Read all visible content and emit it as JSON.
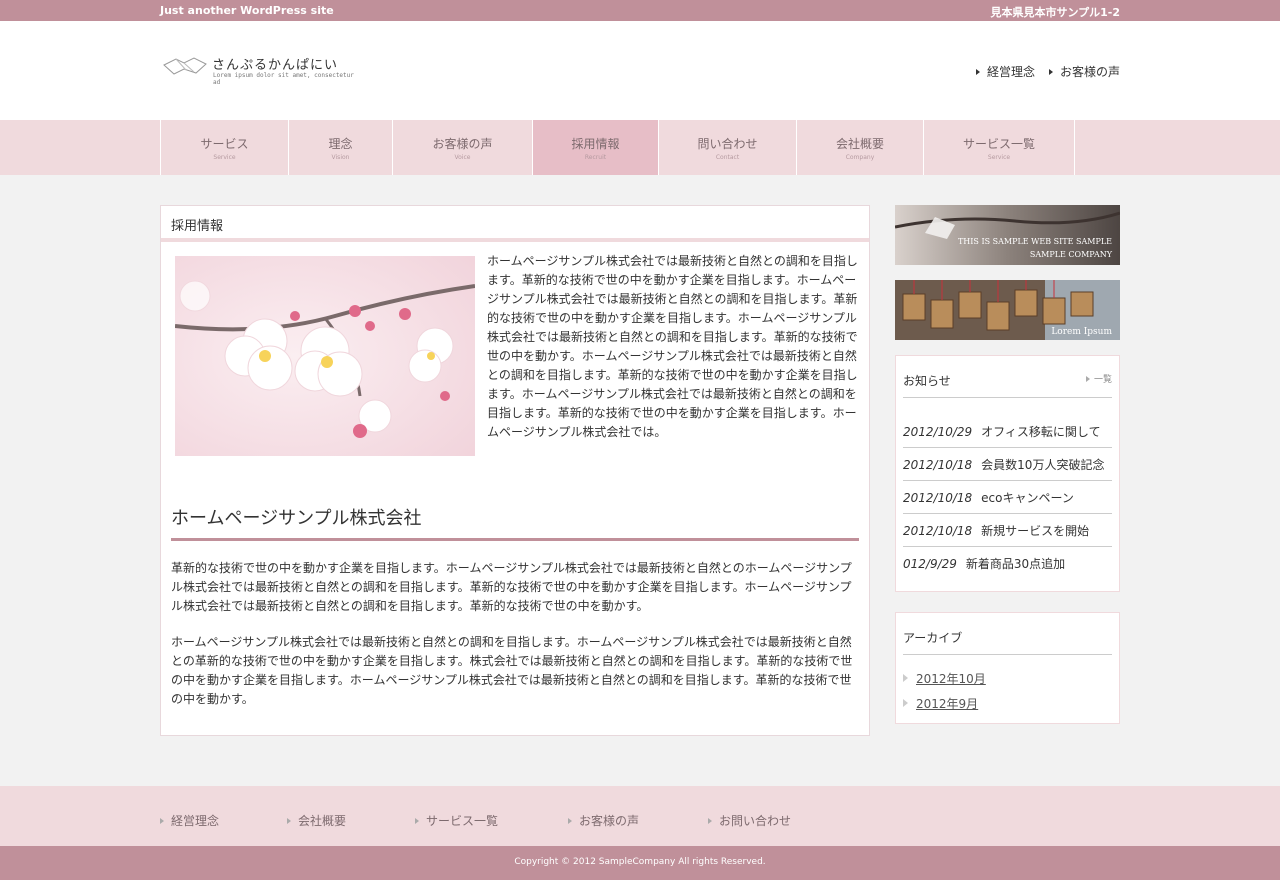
{
  "topbar": {
    "tagline": "Just another WordPress site",
    "address": "見本県見本市サンプル1-2"
  },
  "logo": {
    "name": "さんぷるかんぱにい",
    "tagline": "Lorem ipsum dolor sit amet, consectetur ad"
  },
  "header_links": [
    "経営理念",
    "お客様の声"
  ],
  "nav": [
    {
      "label": "サービス",
      "sub": "Service",
      "active": false
    },
    {
      "label": "理念",
      "sub": "Vision",
      "active": false
    },
    {
      "label": "お客様の声",
      "sub": "Voice",
      "active": false
    },
    {
      "label": "採用情報",
      "sub": "Recruit",
      "active": true
    },
    {
      "label": "問い合わせ",
      "sub": "Contact",
      "active": false
    },
    {
      "label": "会社概要",
      "sub": "Company",
      "active": false
    },
    {
      "label": "サービス一覧",
      "sub": "Service",
      "active": false
    }
  ],
  "main": {
    "title": "採用情報",
    "intro": "ホームページサンプル株式会社では最新技術と自然との調和を目指します。革新的な技術で世の中を動かす企業を目指します。ホームページサンプル株式会社では最新技術と自然との調和を目指します。革新的な技術で世の中を動かす企業を目指します。ホームページサンプル株式会社では最新技術と自然との調和を目指します。革新的な技術で世の中を動かす。ホームページサンプル株式会社では最新技術と自然との調和を目指します。革新的な技術で世の中を動かす企業を目指します。ホームページサンプル株式会社では最新技術と自然との調和を目指します。革新的な技術で世の中を動かす企業を目指します。ホームページサンプル株式会社では。",
    "section_title": "ホームページサンプル株式会社",
    "para1": "革新的な技術で世の中を動かす企業を目指します。ホームページサンプル株式会社では最新技術と自然とのホームページサンプル株式会社では最新技術と自然との調和を目指します。革新的な技術で世の中を動かす企業を目指します。ホームページサンプル株式会社では最新技術と自然との調和を目指します。革新的な技術で世の中を動かす。",
    "para2": "ホームページサンプル株式会社では最新技術と自然との調和を目指します。ホームページサンプル株式会社では最新技術と自然との革新的な技術で世の中を動かす企業を目指します。株式会社では最新技術と自然との調和を目指します。革新的な技術で世の中を動かす企業を目指します。ホームページサンプル株式会社では最新技術と自然との調和を目指します。革新的な技術で世の中を動かす。"
  },
  "banners": {
    "b1_line1": "THIS IS SAMPLE WEB SITE SAMPLE",
    "b1_line2": "SAMPLE COMPANY",
    "b2": "Lorem Ipsum"
  },
  "news": {
    "title": "お知らせ",
    "more": "一覧",
    "items": [
      {
        "date": "2012/10/29",
        "text": "オフィス移転に関して"
      },
      {
        "date": "2012/10/18",
        "text": "会員数10万人突破記念"
      },
      {
        "date": "2012/10/18",
        "text": "ecoキャンペーン"
      },
      {
        "date": "2012/10/18",
        "text": "新規サービスを開始"
      },
      {
        "date": "012/9/29",
        "text": "新着商品30点追加"
      }
    ]
  },
  "archive": {
    "title": "アーカイブ",
    "items": [
      "2012年10月",
      "2012年9月"
    ]
  },
  "footer": {
    "links": [
      "経営理念",
      "会社概要",
      "サービス一覧",
      "お客様の声",
      "お問い合わせ"
    ],
    "copyright": "Copyright © 2012 SampleCompany All rights Reserved."
  },
  "colors": {
    "accent": "#c0909a",
    "nav_bg": "#f0dadd",
    "nav_active": "#e7bec7"
  }
}
